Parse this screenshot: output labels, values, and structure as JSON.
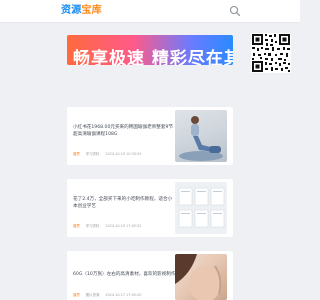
{
  "header": {
    "logo_main": "资源",
    "logo_accent": "宝库",
    "search_icon": "search-icon"
  },
  "banner": {
    "text": "畅享极速 精彩尽在其中"
  },
  "posts": [
    {
      "title": "小红书花1968.00元买来的韩国瑜伽老师整套9节超高清瑜伽课程108G",
      "tag": "普思",
      "category": "学习资料",
      "date": "2024-10-19 10:30:25"
    },
    {
      "title": "花了2.4万，全部买下来的小吃制作教程，适合小本创业学艺",
      "tag": "普思",
      "category": "学习资料",
      "date": "2024-10-19 17:05:32"
    },
    {
      "title": "60G（10万张）左右的高清素材，喜欢的影视制作粉",
      "tag": "普思",
      "category": "图片资源",
      "date": "2024-10-17 17:05:20"
    }
  ],
  "colors": {
    "brand_blue": "#1a8cf0",
    "brand_orange": "#ff8a1f",
    "tag_orange": "#ff7a1f"
  }
}
